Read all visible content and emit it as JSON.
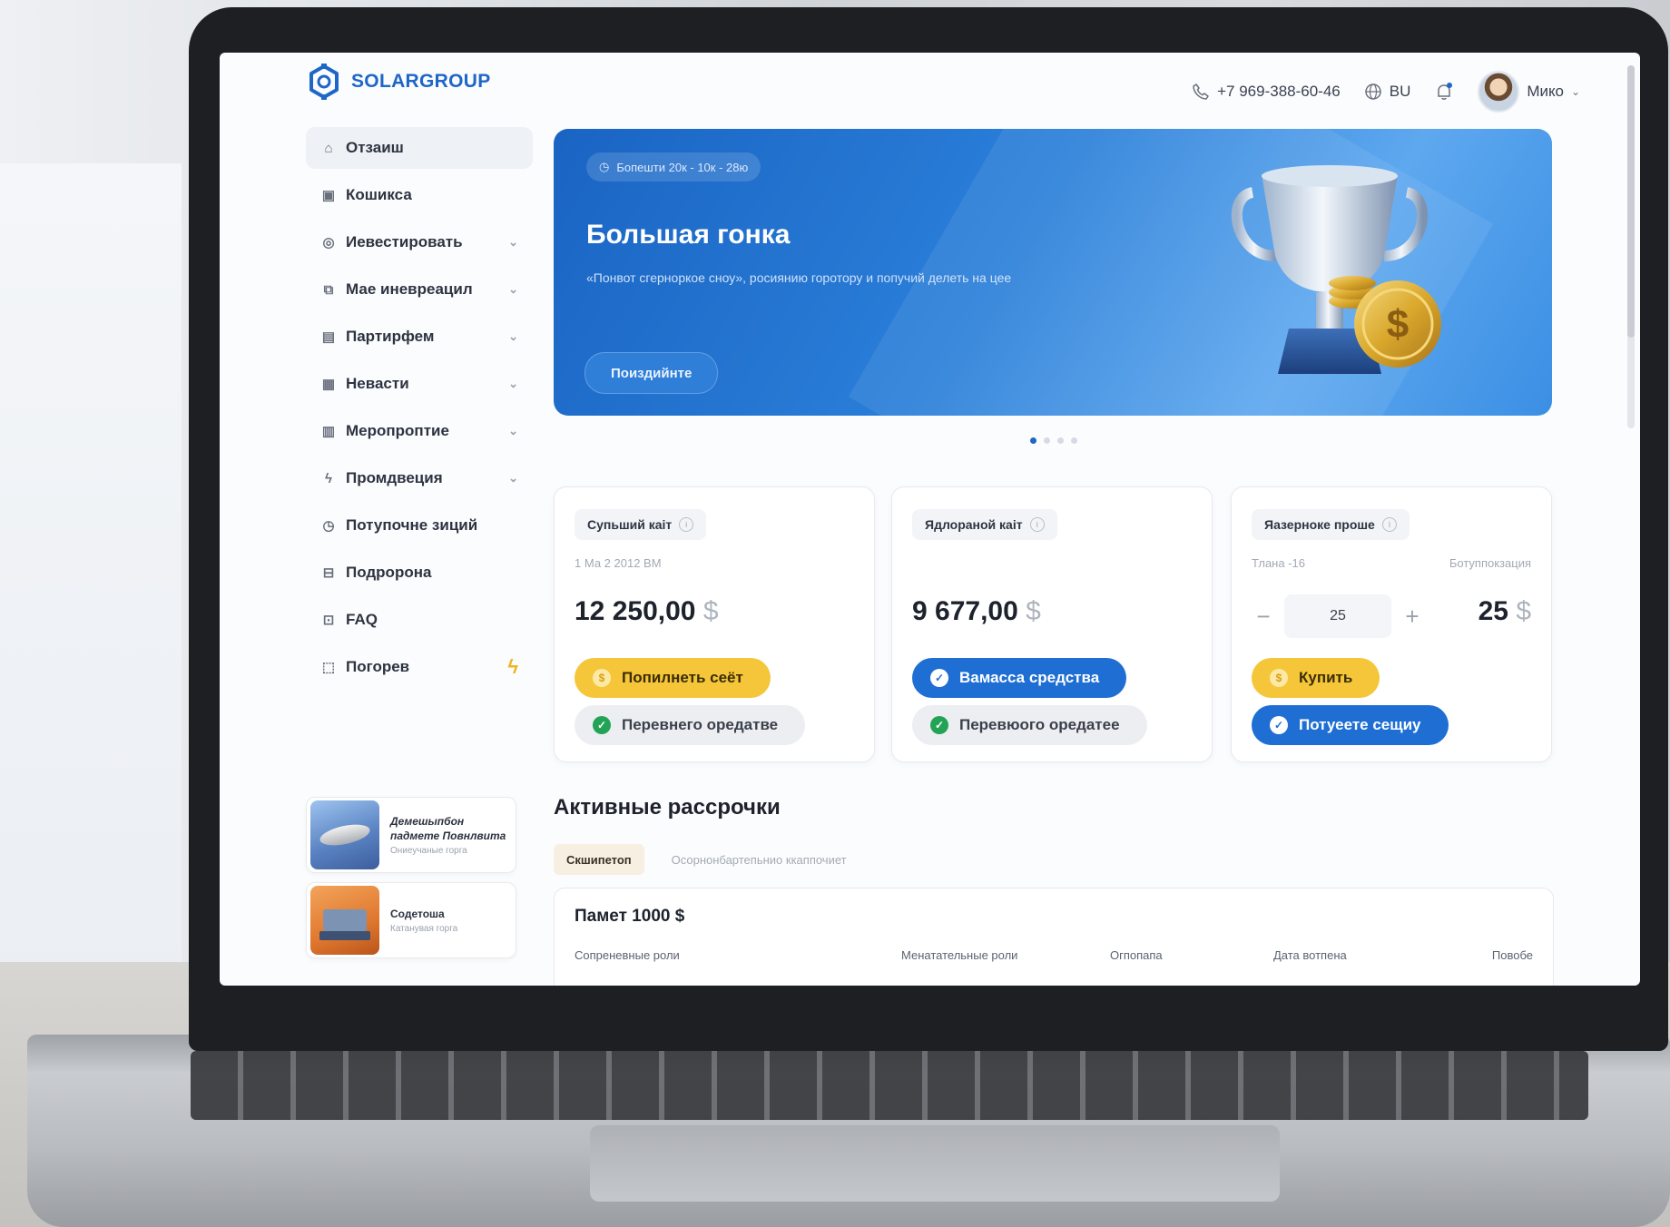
{
  "brand": {
    "name": "SOLARGROUP"
  },
  "header": {
    "phone": "+7 969-388-60-46",
    "language": "BU",
    "user_name": "Mикo"
  },
  "sidebar": {
    "items": [
      {
        "label": "Отзаиш",
        "icon": "home-icon",
        "has_chevron": false,
        "active": true
      },
      {
        "label": "Кошикса",
        "icon": "wallet-icon",
        "has_chevron": false,
        "active": false
      },
      {
        "label": "Иевестировать",
        "icon": "invest-icon",
        "has_chevron": true,
        "active": false
      },
      {
        "label": "Мае иневреацил",
        "icon": "portfolio-icon",
        "has_chevron": true,
        "active": false
      },
      {
        "label": "Партирфем",
        "icon": "partner-icon",
        "has_chevron": true,
        "active": false
      },
      {
        "label": "Невасти",
        "icon": "news-icon",
        "has_chevron": true,
        "active": false
      },
      {
        "label": "Меропроптие",
        "icon": "events-icon",
        "has_chevron": true,
        "active": false
      },
      {
        "label": "Промдвеция",
        "icon": "bolt-icon",
        "has_chevron": true,
        "active": false
      },
      {
        "label": "Потупочне зиций",
        "icon": "clock-icon",
        "has_chevron": false,
        "active": false
      },
      {
        "label": "Подророна",
        "icon": "support-icon",
        "has_chevron": false,
        "active": false
      },
      {
        "label": "FAQ",
        "icon": "faq-icon",
        "has_chevron": false,
        "active": false
      },
      {
        "label": "Погорев",
        "icon": "tag-icon",
        "has_chevron": false,
        "active": false
      }
    ],
    "promos": [
      {
        "title": "Демешыпбон падмете Повнлвита",
        "sub": "Ониеучаные горга"
      },
      {
        "title": "Содетоша",
        "sub": "Катанувая горга"
      }
    ]
  },
  "banner": {
    "date": "Бопешти 20к - 10к - 28ю",
    "title": "Большая гонка",
    "description": "«Понвот сгерноркое сноу», росиянию горотору и попучий делеть на цее",
    "button": "Поиздийнте"
  },
  "carousel": {
    "count": 4,
    "active": 0
  },
  "cards": [
    {
      "tag": "Супьший каіт",
      "sub": "1 Ма 2 2012 ВМ",
      "amount": "12 250,00",
      "currency": "$",
      "primary": "Попилнеть сеёт",
      "secondary": "Перевнего оредатве"
    },
    {
      "tag": "Ядлораной каіт",
      "amount": "9 677,00",
      "currency": "$",
      "primary": "Вамасса средства",
      "secondary": "Перевюого оредатее"
    },
    {
      "tag": "Яазерноке проше",
      "sub_left": "Тлана -16",
      "sub_right": "Ботуппокзация",
      "stepper_value": "25",
      "stepper_minus": "−",
      "stepper_plus": "+",
      "amount": "25",
      "currency": "$",
      "primary": "Купить",
      "secondary": "Потуеете сещиу"
    }
  ],
  "installments": {
    "title": "Активные рассрочки",
    "tabs": [
      {
        "label": "Скшипетоп",
        "active": true
      },
      {
        "label": "Осорнонбартепьнио ккаппочиет",
        "active": false
      }
    ],
    "card_title": "Памет 1000 $",
    "columns": [
      "Сопреневные роли",
      "Менатательные роли",
      "Огпопапа",
      "Дата вотпена",
      "Повобе"
    ]
  },
  "colors": {
    "brand_blue": "#1e66c8",
    "accent_yellow": "#f5c63a",
    "success_green": "#23a356"
  }
}
